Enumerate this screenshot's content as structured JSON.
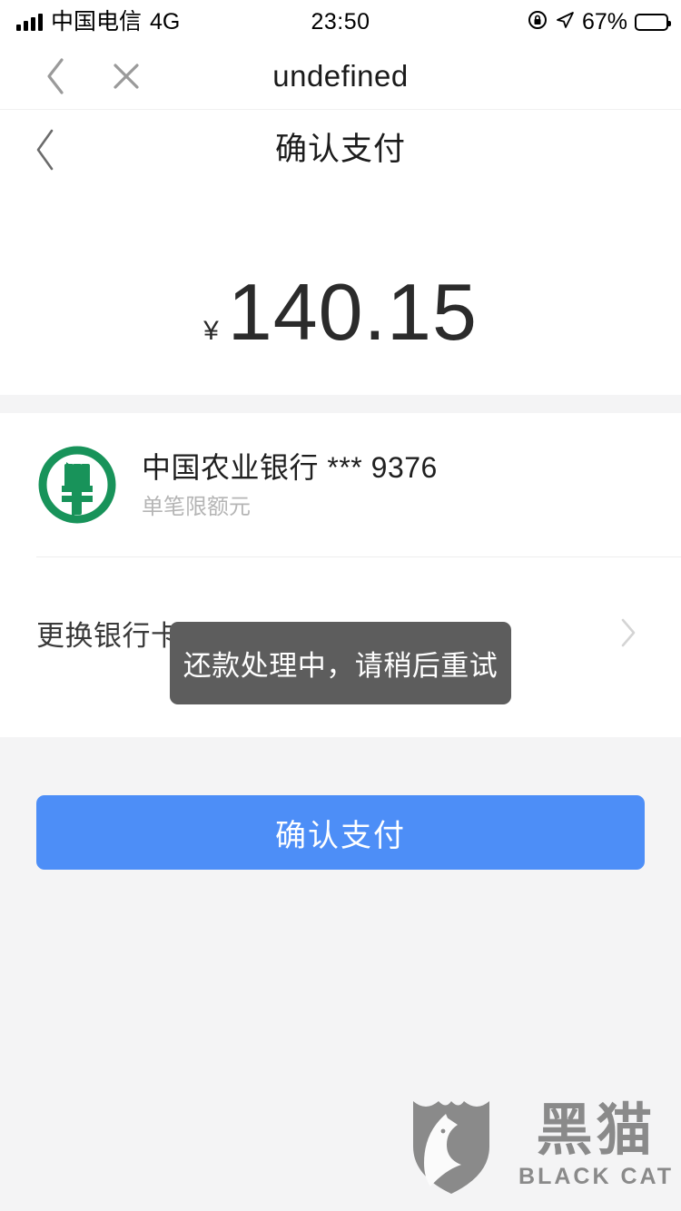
{
  "status_bar": {
    "carrier": "中国电信",
    "network": "4G",
    "time": "23:50",
    "battery_percent": "67%",
    "battery_level": 67,
    "icons": [
      "signal-bars-icon",
      "rotation-lock-icon",
      "location-arrow-icon",
      "battery-icon"
    ]
  },
  "webview_nav": {
    "title": "undefined",
    "back_icon": "chevron-left-icon",
    "close_icon": "close-icon"
  },
  "page_header": {
    "title": "确认支付",
    "back_icon": "chevron-left-icon"
  },
  "amount": {
    "currency_symbol": "¥",
    "value": "140.15"
  },
  "bank_card": {
    "logo_icon": "abc-bank-logo-icon",
    "logo_color": "#18935a",
    "name": "中国农业银行 *** 9376",
    "limit_note": "单笔限额元"
  },
  "change_card_row": {
    "label": "更换银行卡",
    "chevron_icon": "chevron-right-icon"
  },
  "toast": {
    "message": "还款处理中，请稍后重试",
    "background": "#5d5d5d",
    "text_color": "#ffffff"
  },
  "primary_action": {
    "label": "确认支付",
    "color": "#4d8ef7"
  },
  "watermark": {
    "cn": "黑猫",
    "en": "BLACK CAT",
    "icon": "black-cat-shield-icon",
    "color": "#8a8a8a"
  }
}
